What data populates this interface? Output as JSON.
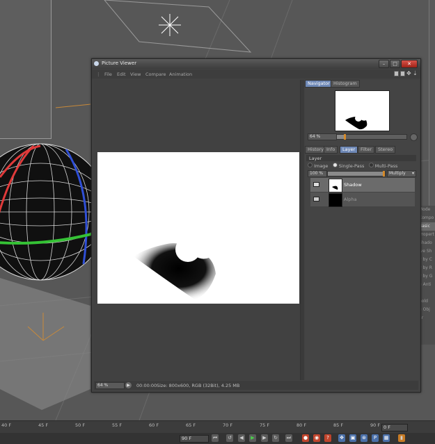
{
  "window": {
    "title": "Picture Viewer"
  },
  "menu": [
    "File",
    "Edit",
    "View",
    "Compare",
    "Animation"
  ],
  "navigator": {
    "tabs": [
      "Navigator",
      "Histogram"
    ],
    "active_tab": "Navigator",
    "zoom": "64 %",
    "zoom_slider_fraction": 0.1
  },
  "info_tabs": {
    "tabs": [
      "History",
      "Info",
      "Layer",
      "Filter",
      "Stereo"
    ],
    "active_tab": "Layer"
  },
  "layer_panel": {
    "heading": "Layer",
    "modes": [
      "Image",
      "Single-Pass",
      "Multi-Pass"
    ],
    "selected_mode": "Single-Pass",
    "opacity": "100 %",
    "opacity_fraction": 1.0,
    "blend_mode": "Multiply",
    "layers": [
      {
        "name": "Shadow",
        "selected": true
      },
      {
        "name": "Alpha",
        "selected": false
      }
    ]
  },
  "statusbar": {
    "zoom": "64 %",
    "timecode": "00:00:00",
    "info": "Size: 800x600, RGB (32Bit), 4.25 MB"
  },
  "attributes_strip": [
    "Mode",
    "Compo",
    "Basic",
    "Propert",
    "Shado",
    "ive Sh",
    "y by C",
    "y by R",
    "y by G",
    "e Anti",
    "-",
    "hold",
    "e Obj",
    "ar"
  ],
  "timeline": {
    "ruler": [
      "40 F",
      "45 F",
      "50 F",
      "55 F",
      "60 F",
      "65 F",
      "70 F",
      "75 F",
      "80 F",
      "85 F",
      "90 F"
    ],
    "end_field": "0 F",
    "frame_field": "90 F"
  },
  "colors": {
    "accent": "#6e88b6",
    "slider_knob": "#d58a2a",
    "close_button": "#c9392c",
    "canvas": "#ffffff"
  },
  "icons": {
    "window": "picture-viewer-icon",
    "minimize": "minimize-icon",
    "maximize": "maximize-icon",
    "close": "close-icon",
    "play": "play-icon",
    "record": "record-icon"
  }
}
